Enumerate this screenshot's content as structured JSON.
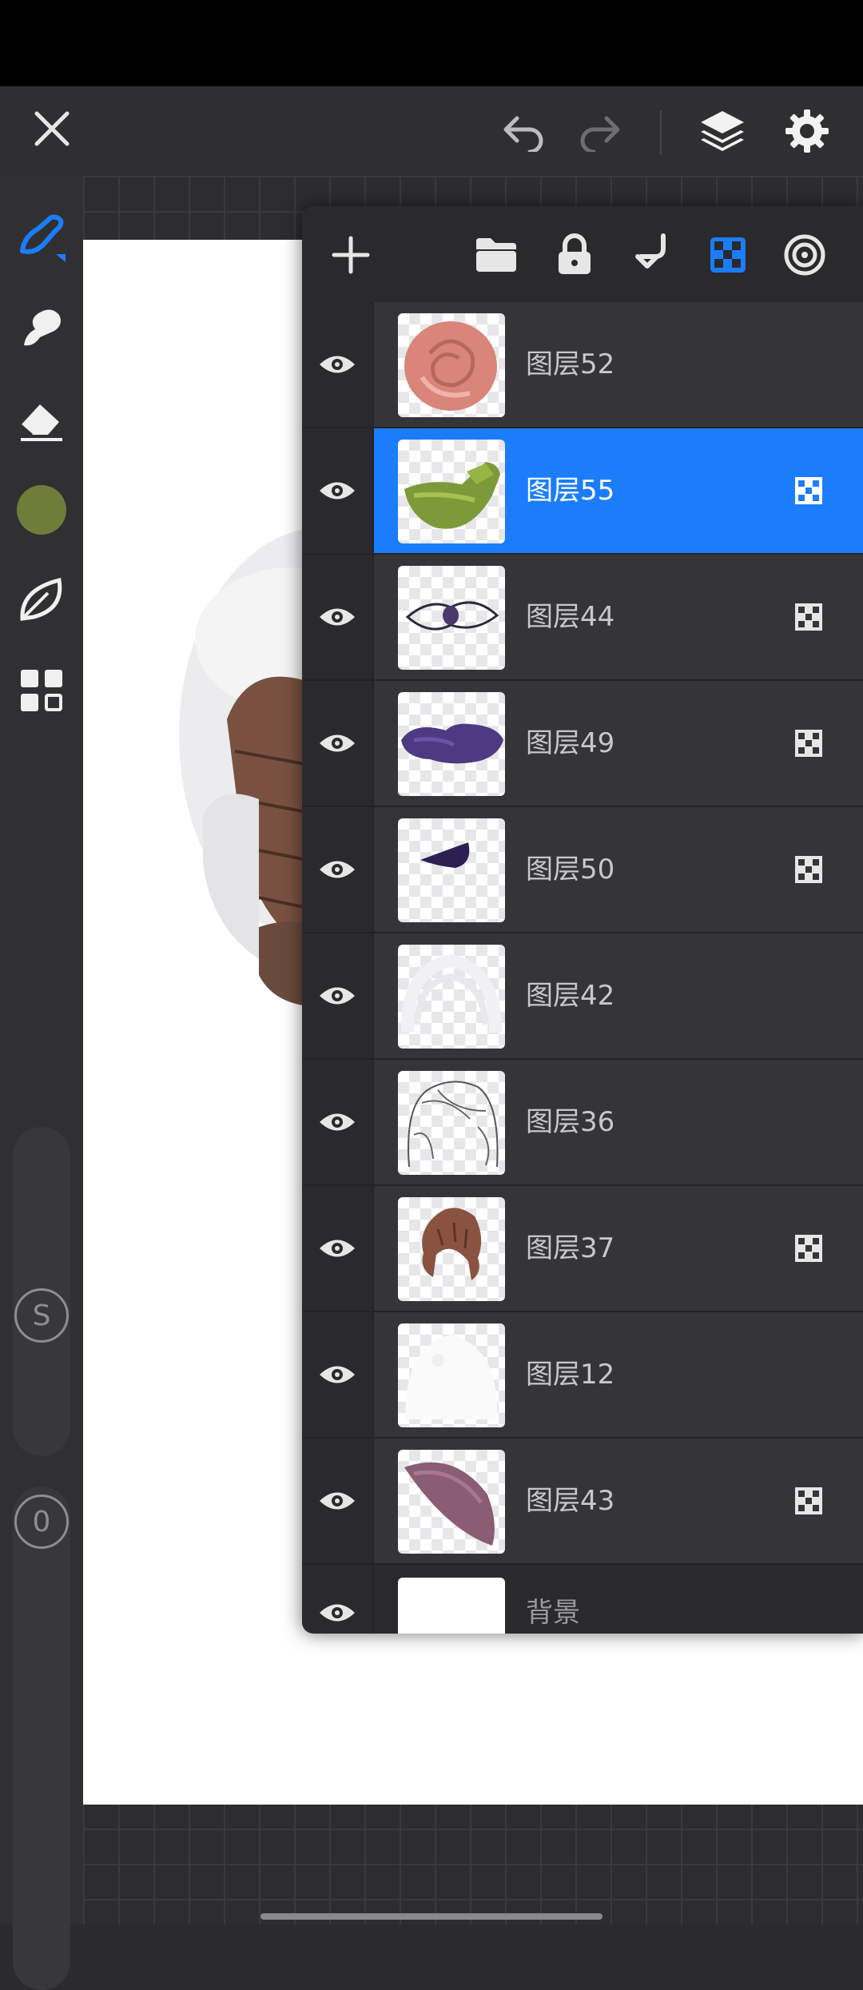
{
  "colors": {
    "accent": "#1b7dfb",
    "current_brush_color": "#6f7d3a",
    "icon": "#e6e6e6"
  },
  "toolbar": {
    "close_icon": "close-icon",
    "undo_icon": "undo-icon",
    "redo_icon": "redo-icon",
    "layers_icon": "layers-icon",
    "settings_icon": "gear-icon"
  },
  "tools": {
    "brush": "brush-icon",
    "smudge": "smudge-icon",
    "eraser": "eraser-icon",
    "color": "color-swatch",
    "leaf": "leaf-icon",
    "grid": "grid-icon",
    "size_label": "S",
    "opacity_label": "0"
  },
  "layers_panel": {
    "toolbar": [
      "add-icon",
      "folder-icon",
      "lock-icon",
      "merge-down-icon",
      "checker-icon",
      "target-icon"
    ],
    "layers": [
      {
        "name": "图层52",
        "blend": false,
        "active": false
      },
      {
        "name": "图层55",
        "blend": true,
        "active": true
      },
      {
        "name": "图层44",
        "blend": true,
        "active": false
      },
      {
        "name": "图层49",
        "blend": true,
        "active": false
      },
      {
        "name": "图层50",
        "blend": true,
        "active": false
      },
      {
        "name": "图层42",
        "blend": false,
        "active": false
      },
      {
        "name": "图层36",
        "blend": false,
        "active": false
      },
      {
        "name": "图层37",
        "blend": true,
        "active": false
      },
      {
        "name": "图层12",
        "blend": false,
        "active": false
      },
      {
        "name": "图层43",
        "blend": true,
        "active": false
      }
    ],
    "background_layer": "背景"
  }
}
